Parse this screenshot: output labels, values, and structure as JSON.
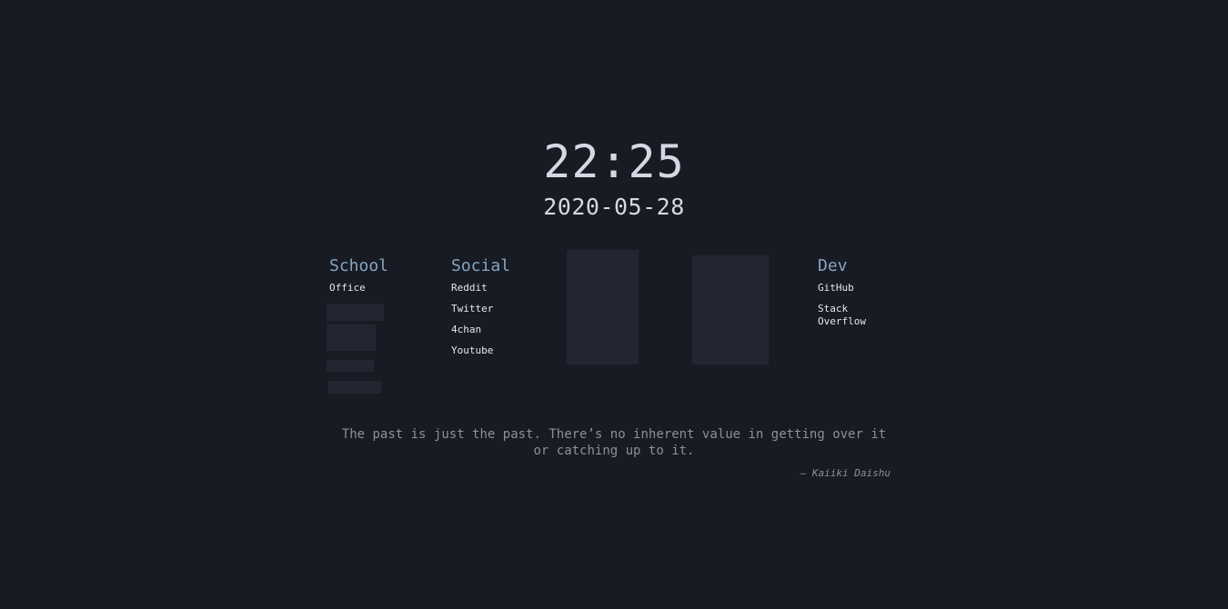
{
  "clock": {
    "time": "22:25",
    "date": "2020-05-28"
  },
  "groups": {
    "school": {
      "title": "School",
      "links": [
        "Office"
      ]
    },
    "social": {
      "title": "Social",
      "links": [
        "Reddit",
        "Twitter",
        "4chan",
        "Youtube"
      ]
    },
    "dev": {
      "title": "Dev",
      "links": [
        "GitHub",
        "Stack Overflow"
      ]
    }
  },
  "quote": {
    "text": "The past is just the past. There’s no inherent value in getting over it or catching up to it.",
    "author": "– Kaiiki Daishu"
  },
  "colors": {
    "background": "#181b23",
    "heading": "#86a5c2",
    "text": "#d3d8e2",
    "muted": "#8b909a",
    "placeholder": "#232630"
  }
}
